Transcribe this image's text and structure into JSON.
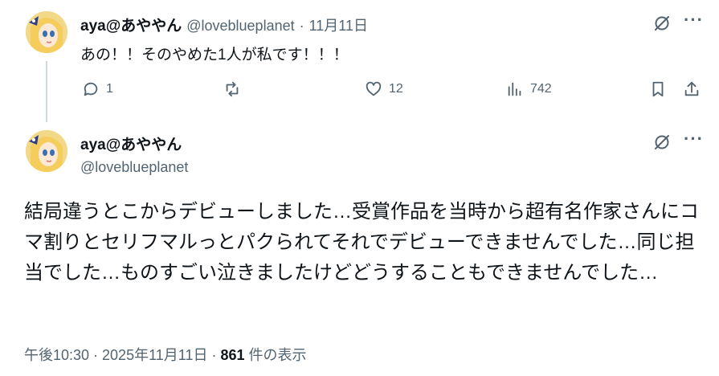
{
  "reply": {
    "display_name": "aya@あややん",
    "handle": "@loveblueplanet",
    "separator": "·",
    "date": "11月11日",
    "text": "あの！！そのやめた1人が私です！！！",
    "stats": {
      "replies": "1",
      "likes": "12",
      "views": "742"
    }
  },
  "main": {
    "display_name": "aya@あややん",
    "handle": "@loveblueplanet",
    "text": "結局違うとこからデビューしました…受賞作品を当時から超有名作家さんにコマ割りとセリフマルっとパクられてそれでデビューできませんでした…同じ担当でした…ものすごい泣きましたけどどうすることもできませんでした…",
    "timestamp": "午後10:30 · 2025年11月11日 · ",
    "views_count": "861",
    "views_label": " 件の表示"
  },
  "icons": [
    "grok-icon",
    "more-icon",
    "reply-icon",
    "repost-icon",
    "like-icon",
    "views-icon",
    "bookmark-icon",
    "share-icon"
  ],
  "colors": {
    "text": "#0f1419",
    "muted": "#536471",
    "thread_line": "#cfd9de"
  }
}
